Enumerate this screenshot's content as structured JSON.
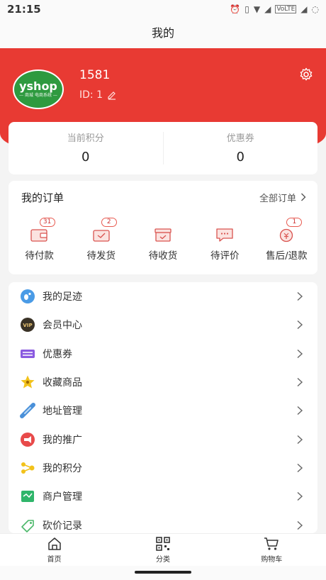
{
  "status_bar": {
    "time": "21:15",
    "network": "VoLTE"
  },
  "nav": {
    "title": "我的"
  },
  "profile": {
    "logo_text": "yshop",
    "logo_subtext": "— 商城 电商系统 —",
    "username": "1581",
    "id_text": "ID: 1",
    "brand_color": "#e83a33",
    "logo_color": "#2e9a3f"
  },
  "stats": {
    "points_label": "当前积分",
    "points_value": "0",
    "coupons_label": "优惠券",
    "coupons_value": "0"
  },
  "orders": {
    "title": "我的订单",
    "all_label": "全部订单",
    "items": [
      {
        "label": "待付款",
        "badge": "31",
        "icon": "wallet-icon"
      },
      {
        "label": "待发货",
        "badge": "2",
        "icon": "package-check-icon"
      },
      {
        "label": "待收货",
        "badge": "",
        "icon": "delivery-box-icon"
      },
      {
        "label": "待评价",
        "badge": "",
        "icon": "comment-icon"
      },
      {
        "label": "售后/退款",
        "badge": "1",
        "icon": "refund-icon"
      }
    ]
  },
  "menu": {
    "items": [
      {
        "label": "我的足迹",
        "icon": "footprint-icon",
        "color": "#3d8fe0"
      },
      {
        "label": "会员中心",
        "icon": "vip-icon",
        "color": "#3a3226"
      },
      {
        "label": "优惠券",
        "icon": "coupon-icon",
        "color": "#8a5ae0"
      },
      {
        "label": "收藏商品",
        "icon": "star-icon",
        "color": "#f2c21b"
      },
      {
        "label": "地址管理",
        "icon": "location-pin-icon",
        "color": "#4a90d9"
      },
      {
        "label": "我的推广",
        "icon": "promotion-icon",
        "color": "#e84a4a"
      },
      {
        "label": "我的积分",
        "icon": "points-icon",
        "color": "#f2c21b"
      },
      {
        "label": "商户管理",
        "icon": "merchant-icon",
        "color": "#2fb56a"
      },
      {
        "label": "砍价记录",
        "icon": "bargain-icon",
        "color": "#4cb86a"
      }
    ]
  },
  "tabbar": {
    "items": [
      {
        "label": "首页",
        "icon": "home-icon"
      },
      {
        "label": "分类",
        "icon": "qrcode-icon"
      },
      {
        "label": "购物车",
        "icon": "cart-icon"
      }
    ]
  }
}
